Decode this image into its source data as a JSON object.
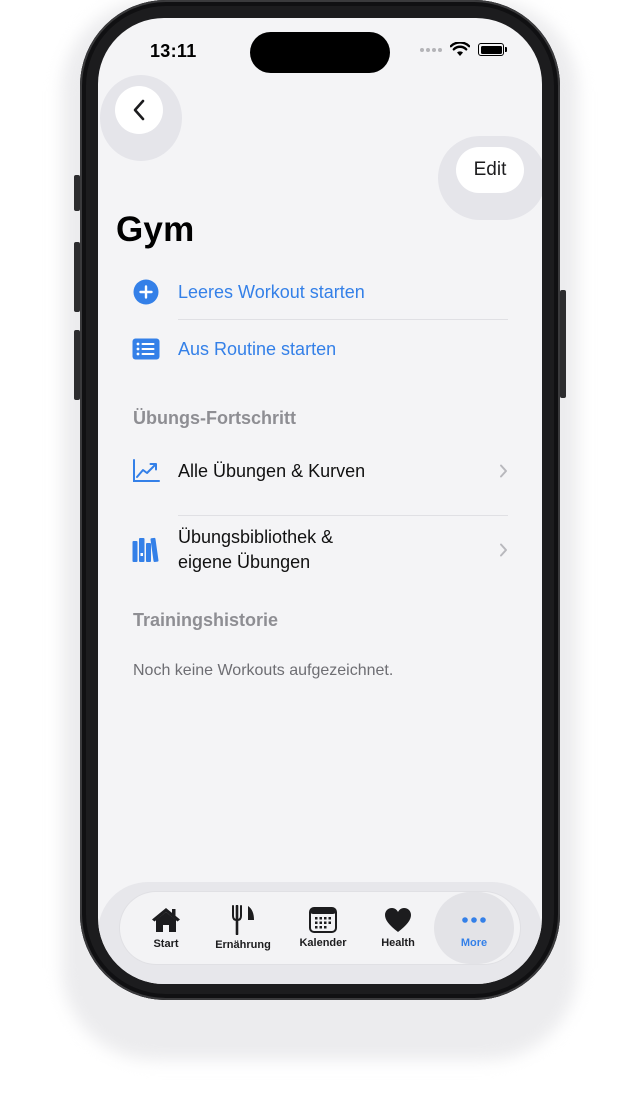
{
  "status": {
    "time": "13:11"
  },
  "nav": {
    "edit_label": "Edit"
  },
  "page": {
    "title": "Gym"
  },
  "actions": [
    {
      "label": "Leeres Workout starten",
      "icon": "plus-circle-icon"
    },
    {
      "label": "Aus Routine starten",
      "icon": "list-icon"
    }
  ],
  "progress_section": {
    "header": "Übungs-Fortschritt",
    "items": [
      {
        "label": "Alle Übungen & Kurven",
        "icon": "chart-icon"
      },
      {
        "label_line1": "Übungsbibliothek &",
        "label_line2": "eigene Übungen",
        "icon": "books-icon"
      }
    ]
  },
  "history_section": {
    "header": "Trainingshistorie",
    "empty_text": "Noch keine Workouts aufgezeichnet."
  },
  "tabs": [
    {
      "label": "Start",
      "icon": "house-icon"
    },
    {
      "label": "Ernährung",
      "icon": "fork-knife-icon"
    },
    {
      "label": "Kalender",
      "icon": "calendar-icon"
    },
    {
      "label": "Health",
      "icon": "heart-icon"
    },
    {
      "label": "More",
      "icon": "ellipsis-icon",
      "active": true
    }
  ],
  "colors": {
    "accent": "#3480e8",
    "background": "#f4f4f6",
    "secondary_text": "#8e8e93"
  }
}
